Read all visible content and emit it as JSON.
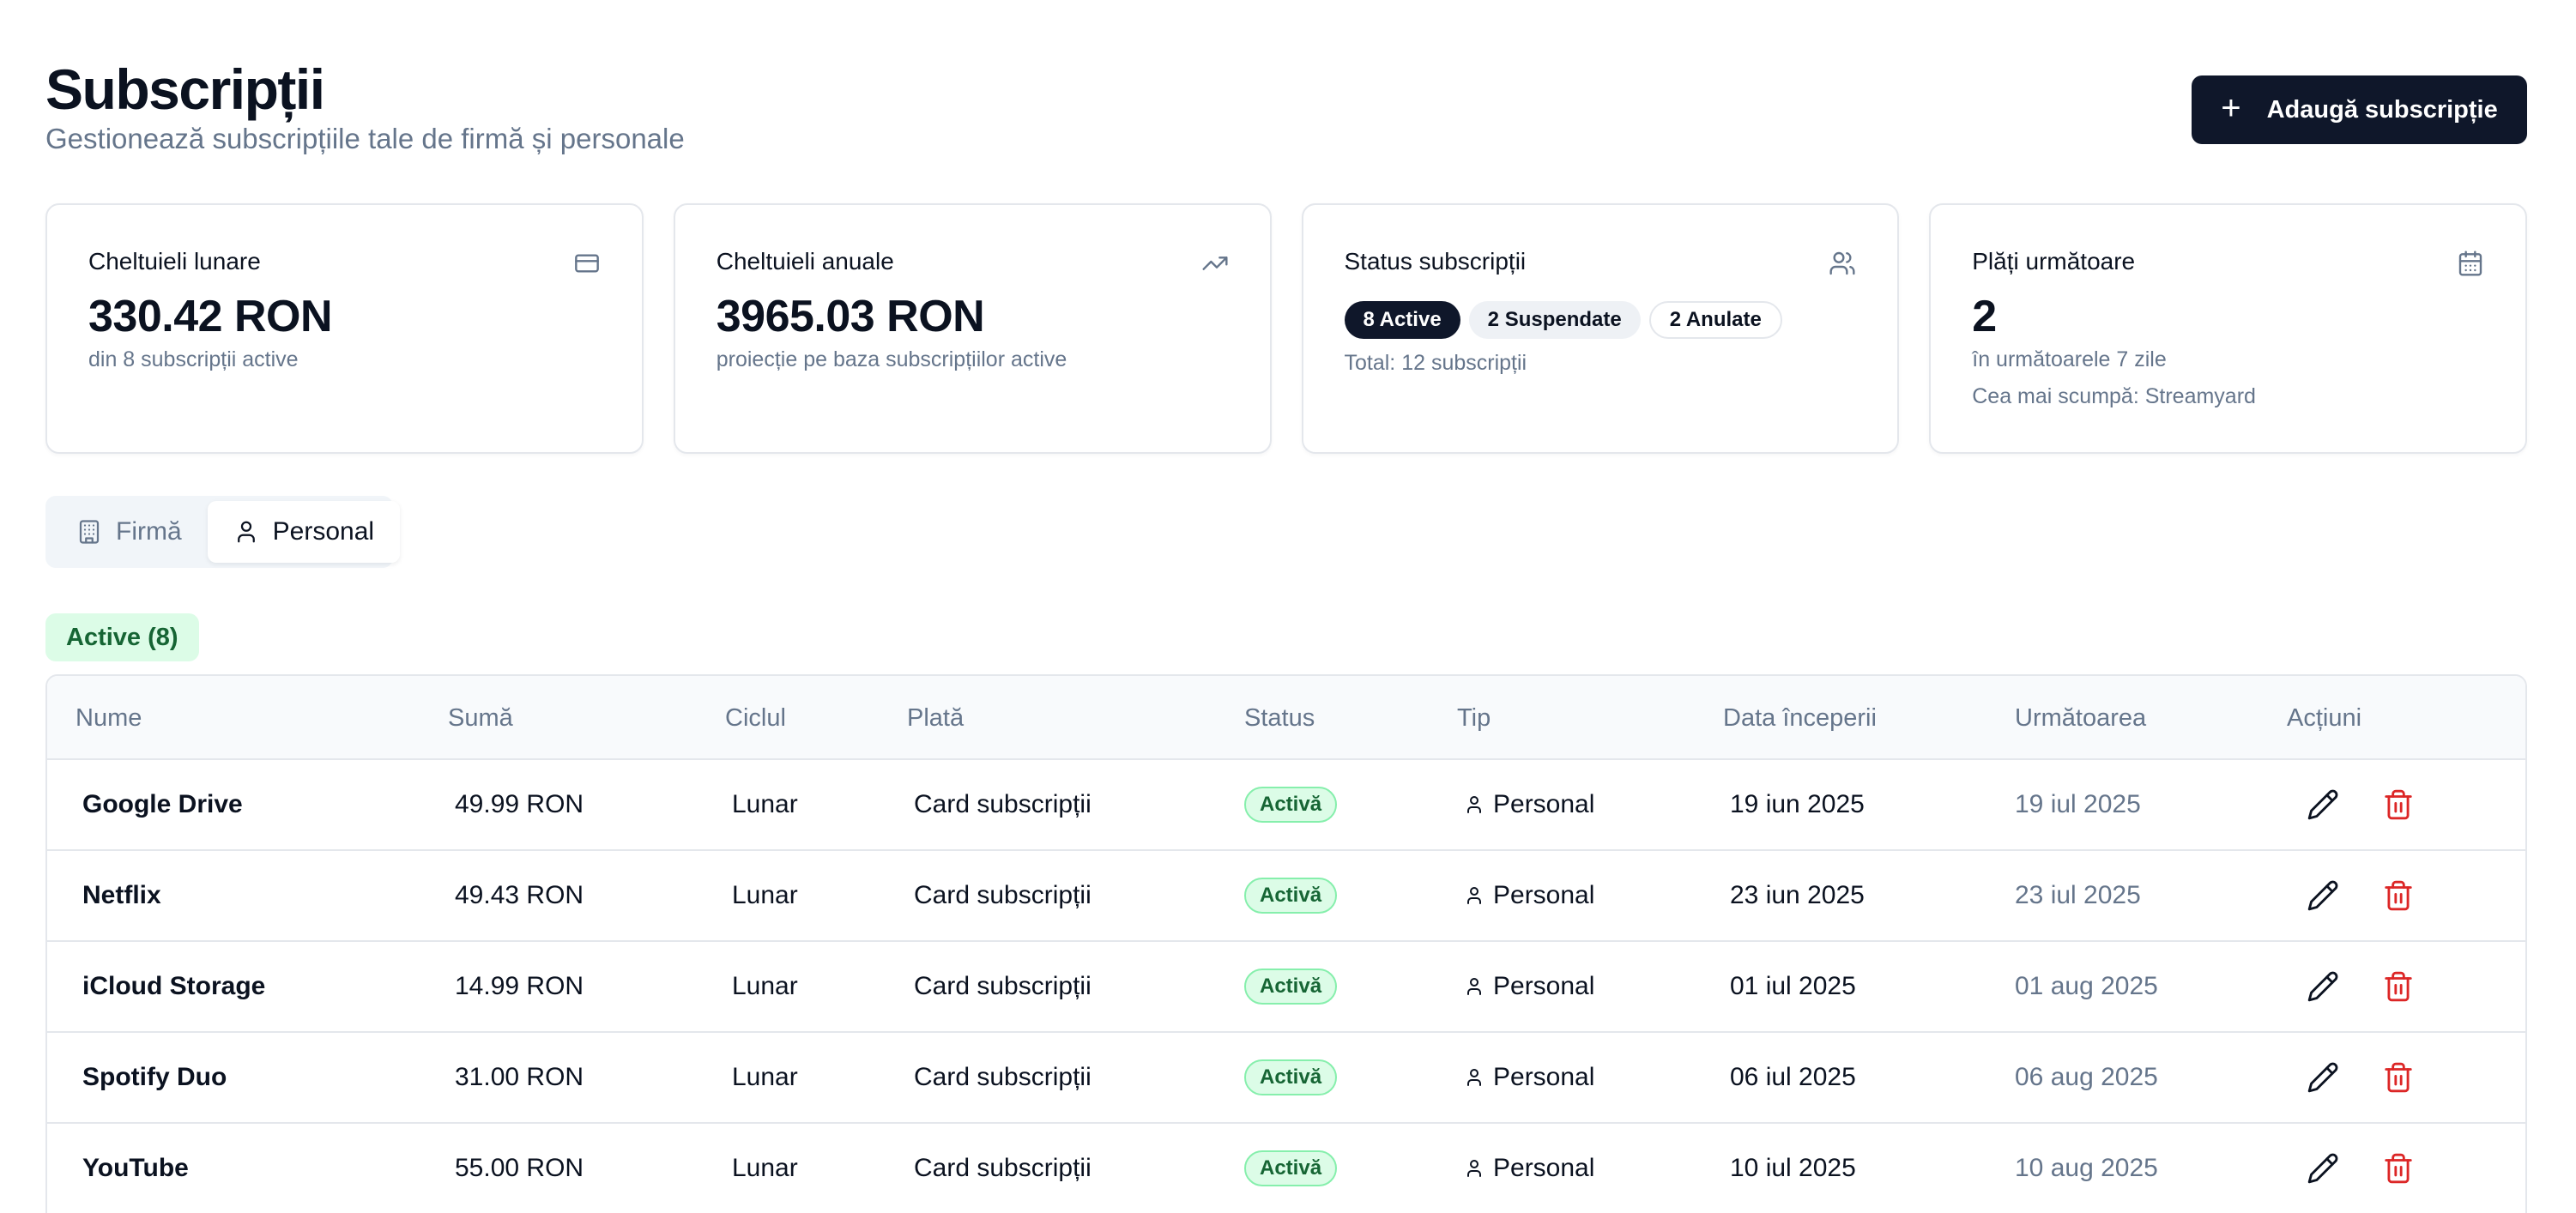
{
  "header": {
    "title": "Subscripții",
    "subtitle": "Gestionează subscripțiile tale de firmă și personale",
    "add_button_label": "Adaugă subscripție"
  },
  "cards": {
    "monthly": {
      "title": "Cheltuieli lunare",
      "value": "330.42 RON",
      "sub": "din 8 subscripții active",
      "icon": "credit-card-icon"
    },
    "yearly": {
      "title": "Cheltuieli anuale",
      "value": "3965.03 RON",
      "sub": "proiecție pe baza subscripțiilor active",
      "icon": "trending-up-icon"
    },
    "status": {
      "title": "Status subscripții",
      "pill_active": "8 Active",
      "pill_suspended": "2 Suspendate",
      "pill_cancelled": "2 Anulate",
      "total": "Total: 12 subscripții",
      "icon": "users-icon"
    },
    "upcoming": {
      "title": "Plăți următoare",
      "value": "2",
      "sub": "în următoarele 7 zile",
      "sub2": "Cea mai scumpă: Streamyard",
      "icon": "calendar-icon"
    }
  },
  "tabs": [
    {
      "label": "Firmă",
      "icon": "building-icon",
      "active": false
    },
    {
      "label": "Personal",
      "icon": "user-icon",
      "active": true
    }
  ],
  "section": {
    "label": "Active (8)"
  },
  "table": {
    "headers": [
      "Nume",
      "Sumă",
      "Ciclul",
      "Plată",
      "Status",
      "Tip",
      "Data începerii",
      "Următoarea",
      "Acțiuni"
    ],
    "rows": [
      {
        "name": "Google Drive",
        "amount": "49.99 RON",
        "cycle": "Lunar",
        "payment": "Card subscripții",
        "status": "Activă",
        "type": "Personal",
        "start": "19 iun 2025",
        "next": "19 iul 2025"
      },
      {
        "name": "Netflix",
        "amount": "49.43 RON",
        "cycle": "Lunar",
        "payment": "Card subscripții",
        "status": "Activă",
        "type": "Personal",
        "start": "23 iun 2025",
        "next": "23 iul 2025"
      },
      {
        "name": "iCloud Storage",
        "amount": "14.99 RON",
        "cycle": "Lunar",
        "payment": "Card subscripții",
        "status": "Activă",
        "type": "Personal",
        "start": "01 iul 2025",
        "next": "01 aug 2025"
      },
      {
        "name": "Spotify Duo",
        "amount": "31.00 RON",
        "cycle": "Lunar",
        "payment": "Card subscripții",
        "status": "Activă",
        "type": "Personal",
        "start": "06 iul 2025",
        "next": "06 aug 2025"
      },
      {
        "name": "YouTube",
        "amount": "55.00 RON",
        "cycle": "Lunar",
        "payment": "Card subscripții",
        "status": "Activă",
        "type": "Personal",
        "start": "10 iul 2025",
        "next": "10 aug 2025"
      }
    ]
  },
  "colors": {
    "primary": "#0f172a",
    "muted_text": "#65758b",
    "success_bg": "#dcfce7",
    "success_text": "#166534",
    "danger": "#dc2626"
  }
}
